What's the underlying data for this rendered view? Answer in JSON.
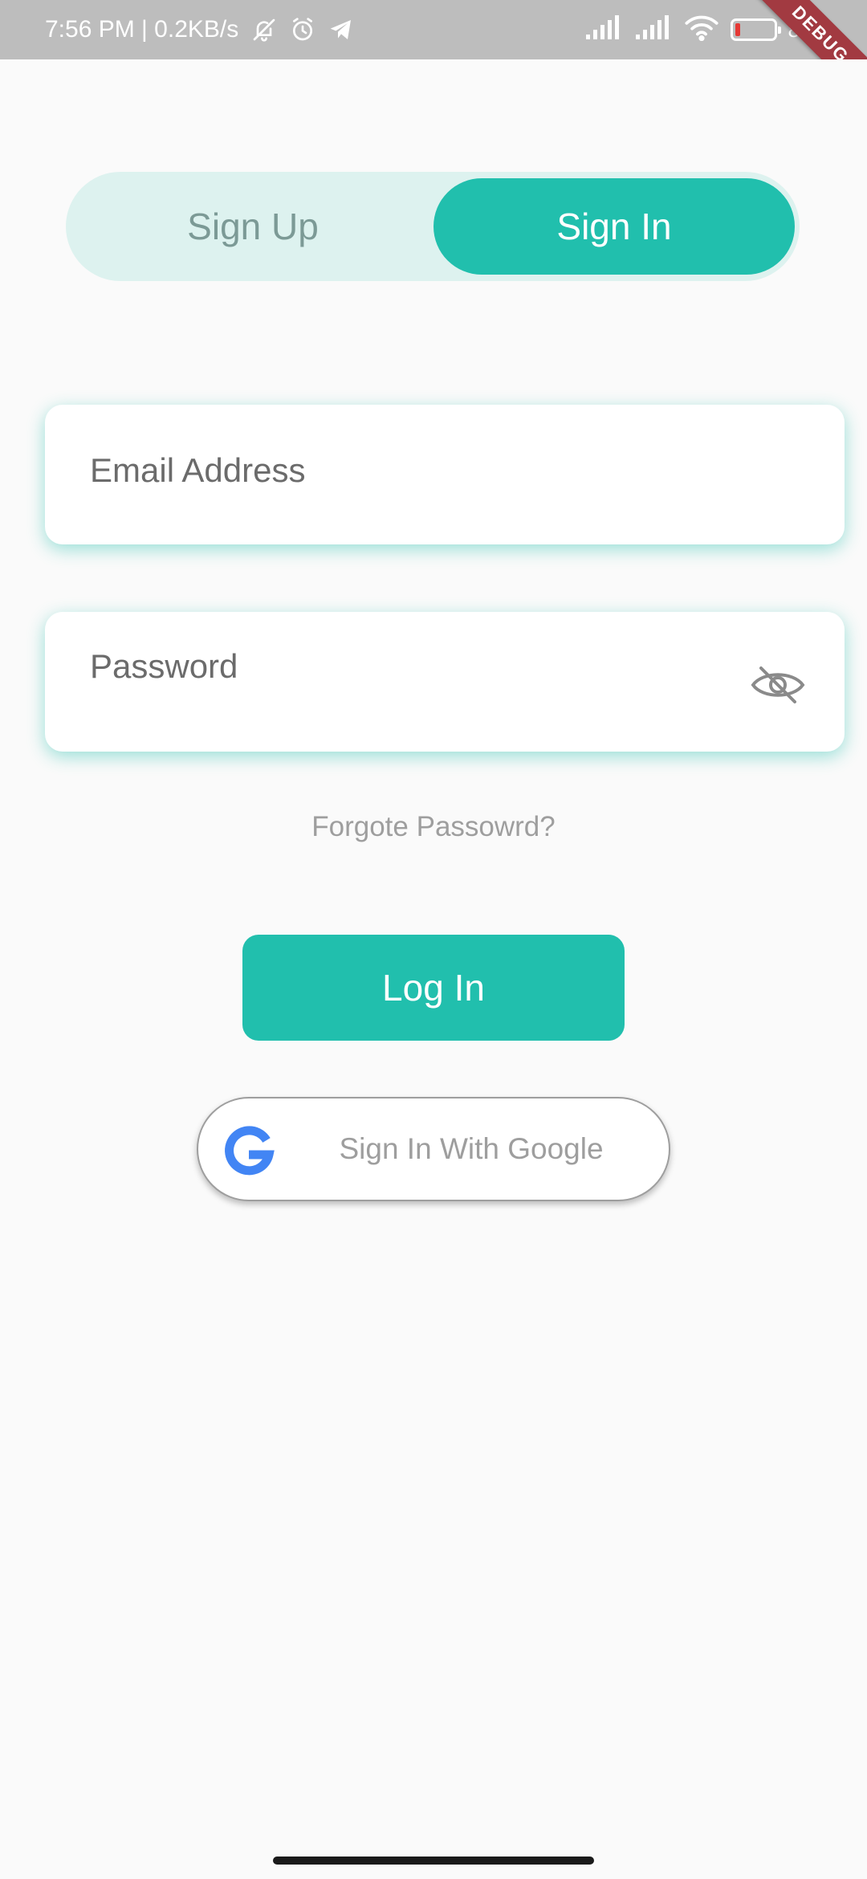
{
  "status_bar": {
    "time_speed": "7:56 PM | 0.2KB/s",
    "battery_level_percent": 8,
    "battery_text": "8",
    "debug_ribbon": "DEBUG",
    "icons": [
      "bell-off-icon",
      "alarm-icon",
      "telegram-icon",
      "signal-icon",
      "signal-icon",
      "wifi-icon",
      "battery-icon"
    ]
  },
  "tabs": {
    "sign_up": "Sign Up",
    "sign_in": "Sign In",
    "active": "sign_in"
  },
  "form": {
    "email_placeholder": "Email Address",
    "email_value": "",
    "password_placeholder": "Password",
    "password_value": ""
  },
  "forgot_password": "Forgote Passowrd?",
  "login_button": "Log In",
  "google_button": "Sign In With Google",
  "colors": {
    "accent": "#21bfad",
    "tab_track": "#ddf2ef",
    "muted_text": "#9e9e9e",
    "status_bar": "#bdbdbd",
    "debug_ribbon": "#a23a41",
    "battery_low": "#e53935",
    "google_blue": "#4285f4"
  }
}
